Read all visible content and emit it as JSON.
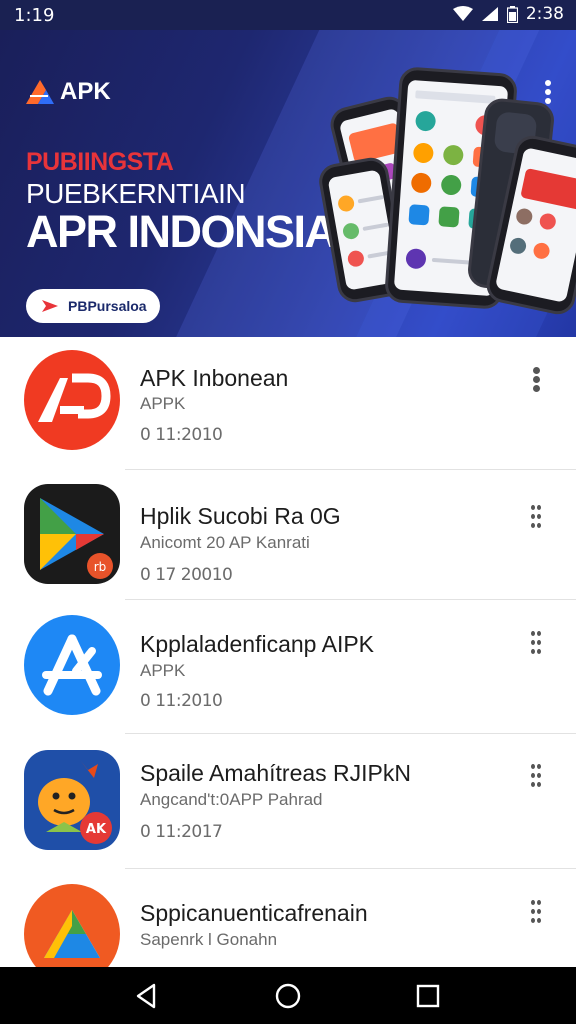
{
  "status_bar": {
    "time": "1:19",
    "battery_time": "2:38"
  },
  "banner": {
    "logo_text": "APK",
    "line1": "PUBIINGSTA",
    "line2": "PUEBKERNTIAIN",
    "line3": "APR INDONSIA",
    "button_label": "PBPursaloa"
  },
  "apps": [
    {
      "title": "APK Inbonean",
      "subtitle": "APPK",
      "date": "0 11:2010",
      "icon": "apk-red-logo-icon",
      "color": "#f03a22"
    },
    {
      "title": "Hplik Sucobi Ra 0G",
      "subtitle": "Anicomt 20 AP  Kanrati",
      "date": "0 17 20010",
      "icon": "play-triangle-icon",
      "color": "#1b1b1b"
    },
    {
      "title": "Kpplaladenficanp AIPK",
      "subtitle": "APPK",
      "date": "0 11:2010",
      "icon": "app-store-a-icon",
      "color": "#1e88f5"
    },
    {
      "title": "Spaile Amahítreas RJIPkN",
      "subtitle": "Angcand't:0APP  Pahrad",
      "date": "0 11:2017",
      "icon": "mascot-apk-icon",
      "color": "#1f4fa8"
    },
    {
      "title": "Sppicanuenticafrenain",
      "subtitle": "Sapenrk l Gonahn",
      "date": "",
      "icon": "drive-triangle-icon",
      "color": "#f05a22"
    }
  ]
}
